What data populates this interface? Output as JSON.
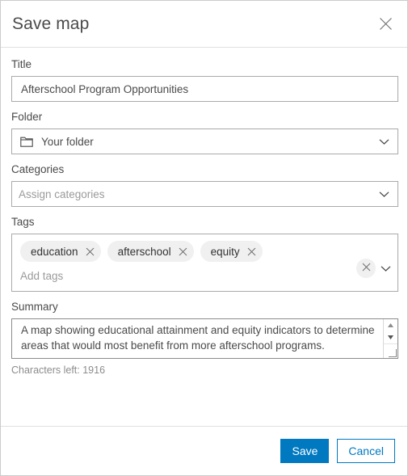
{
  "dialog": {
    "title": "Save map",
    "close_icon": "close-icon"
  },
  "fields": {
    "title": {
      "label": "Title",
      "value": "Afterschool Program Opportunities",
      "placeholder": "Title"
    },
    "folder": {
      "label": "Folder",
      "value": "Your folder",
      "icon": "folder-icon",
      "chevron": "chevron-down-icon"
    },
    "categories": {
      "label": "Categories",
      "value": "",
      "placeholder": "Assign categories",
      "chevron": "chevron-down-icon"
    },
    "tags": {
      "label": "Tags",
      "chips": [
        {
          "label": "education",
          "remove_icon": "close-icon"
        },
        {
          "label": "afterschool",
          "remove_icon": "close-icon"
        },
        {
          "label": "equity",
          "remove_icon": "close-icon"
        }
      ],
      "placeholder": "Add tags",
      "clear_icon": "close-icon",
      "chevron": "chevron-down-icon"
    },
    "summary": {
      "label": "Summary",
      "value": "A map showing educational attainment and equity indicators to determine areas that would most benefit from more afterschool programs.",
      "placeholder": "Summary",
      "characters_left": "Characters left: 1916",
      "scroll_up_icon": "triangle-up-icon",
      "scroll_down_icon": "triangle-down-icon",
      "resize_icon": "resize-grip-icon"
    }
  },
  "footer": {
    "save_label": "Save",
    "cancel_label": "Cancel"
  },
  "colors": {
    "accent": "#0079c1",
    "border": "#aaaaaa",
    "text": "#4a4a4a",
    "placeholder": "#9a9a9a",
    "chip_bg": "#f0f0f0"
  }
}
